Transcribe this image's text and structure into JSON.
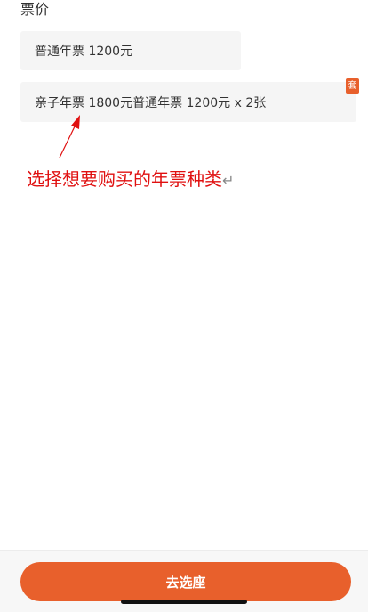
{
  "section": {
    "title": "票价"
  },
  "ticket_options": [
    {
      "label": "普通年票 1200元"
    },
    {
      "label": "亲子年票 1800元普通年票 1200元 x 2张",
      "badge": "套"
    }
  ],
  "annotation": {
    "text": "选择想要购买的年票种类",
    "return_mark": "↵",
    "color": "#e01010"
  },
  "footer": {
    "button_label": "去选座"
  },
  "colors": {
    "accent": "#e8602c",
    "option_bg": "#f5f5f5"
  }
}
